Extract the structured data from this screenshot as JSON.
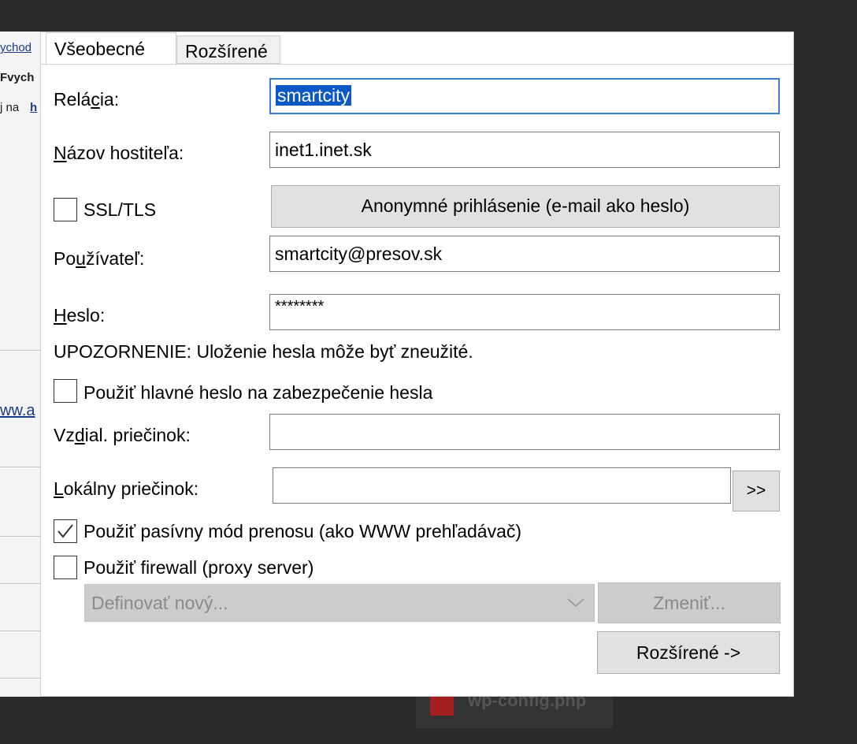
{
  "background": {
    "fragments": [
      "ychod",
      "Fvych",
      "j na",
      "h",
      "ww.a",
      "wp-config.php"
    ]
  },
  "dialog": {
    "tabs": [
      {
        "label": "Všeobecné",
        "active": true
      },
      {
        "label": "Rozšírené",
        "active": false
      }
    ],
    "session": {
      "label_pre": "Relá",
      "label_key": "c",
      "label_post": "ia:",
      "value": "smartcity"
    },
    "host": {
      "label_key": "N",
      "label_post": "ázov hostiteľa:",
      "value": "inet1.inet.sk"
    },
    "ssl": {
      "label": "SSL/TLS",
      "checked": false
    },
    "anon_button": "Anonymné prihlásenie (e-mail ako heslo)",
    "user": {
      "label_pre": "Po",
      "label_key": "u",
      "label_post": "žívateľ:",
      "value": "smartcity@presov.sk"
    },
    "password": {
      "label_key": "H",
      "label_post": "eslo:",
      "value": "********"
    },
    "warning": "UPOZORNENIE: Uloženie hesla môže byť zneužité.",
    "master_password": {
      "label": "Použiť hlavné heslo na zabezpečenie hesla",
      "checked": false
    },
    "remote_folder": {
      "label_pre": "Vz",
      "label_key": "d",
      "label_post": "ial. priečinok:",
      "value": ""
    },
    "local_folder": {
      "label_key": "L",
      "label_post": "okálny priečinok:",
      "value": "",
      "browse_label": ">>"
    },
    "passive": {
      "label": "Použiť pasívny mód prenosu (ako WWW prehľadávač)",
      "checked": true
    },
    "firewall": {
      "label": "Použiť firewall (proxy server)",
      "checked": false
    },
    "proxy_select": {
      "value": "Definovať nový..."
    },
    "change_button": "Zmeniť...",
    "advanced_button": "Rozšírené ->"
  },
  "colors": {
    "focus_border": "#3b7bd8",
    "selection": "#0b58c7",
    "disabled": "#cccccc"
  }
}
